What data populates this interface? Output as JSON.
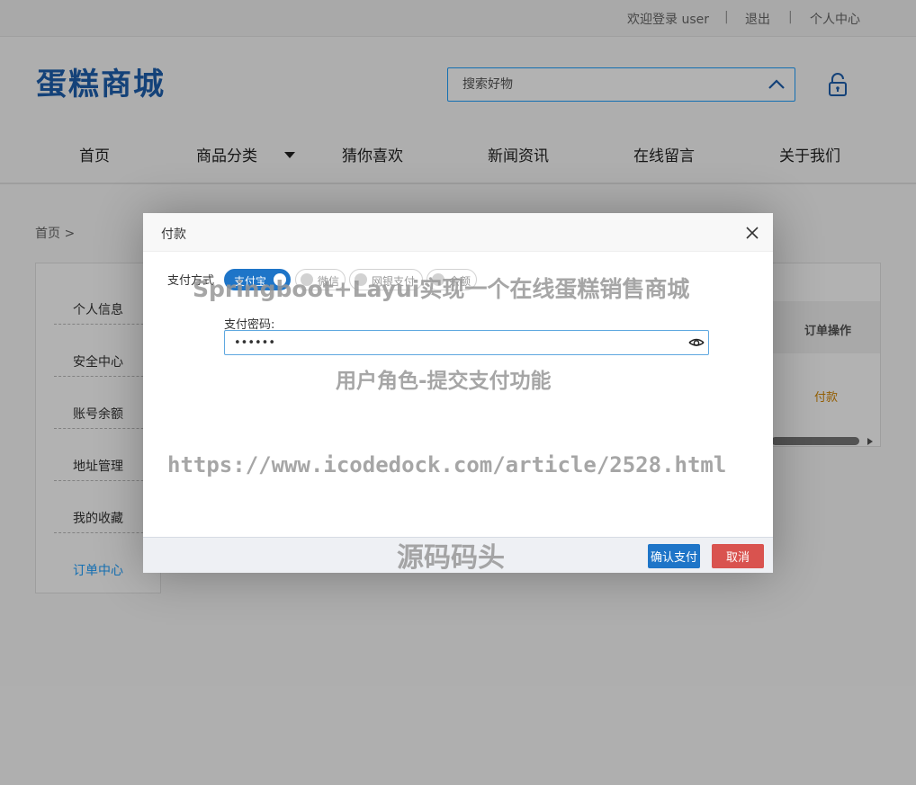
{
  "topbar": {
    "welcome": "欢迎登录 user",
    "separator": "|",
    "logout": "退出",
    "personal_center": "个人中心"
  },
  "header": {
    "logo": "蛋糕商城",
    "search_placeholder": "搜索好物"
  },
  "nav": {
    "items": [
      "首页",
      "商品分类",
      "猜你喜欢",
      "新闻资讯",
      "在线留言",
      "关于我们"
    ]
  },
  "breadcrumb": "首页 >",
  "side_menu": {
    "items": [
      "个人信息",
      "安全中心",
      "账号余额",
      "地址管理",
      "我的收藏",
      "订单中心"
    ],
    "active": "订单中心"
  },
  "order_table": {
    "op_header": "订单操作",
    "pay_link": "付款"
  },
  "modal": {
    "title": "付款",
    "pay_method_label": "支付方式",
    "methods": [
      "支付宝",
      "微信",
      "网银支付",
      "余额"
    ],
    "selected_method": "支付宝",
    "password_label": "支付密码:",
    "password_value": "••••••",
    "confirm_label": "确认支付",
    "cancel_label": "取消"
  },
  "colors": {
    "primary": "#1e75c8",
    "danger": "#d9534f",
    "logo": "#1e5fae",
    "accent_link": "#1e9fff",
    "pay_link": "#d48806"
  },
  "watermarks": {
    "line1": "Springboot+Layui实现一个在线蛋糕销售商城",
    "line2": "用户角色-提交支付功能",
    "line3": "https://www.icodedock.com/article/2528.html",
    "line4": "源码码头"
  }
}
